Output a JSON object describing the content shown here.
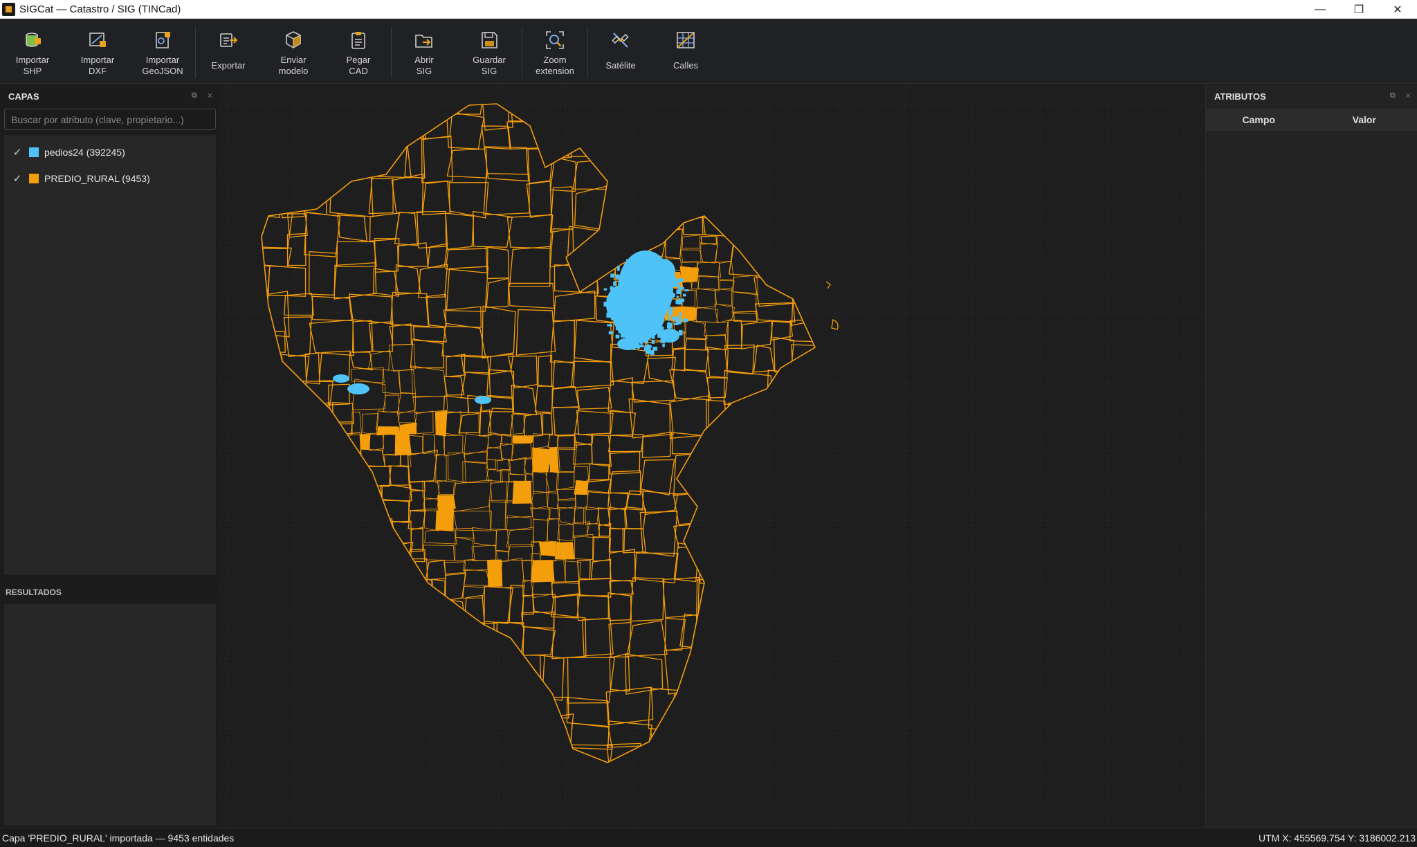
{
  "window": {
    "title": "SIGCat — Catastro / SIG (TINCad)",
    "minimize": "—",
    "maximize": "❐",
    "close": "✕"
  },
  "toolbar": {
    "import_shp": "Importar\nSHP",
    "import_dxf": "Importar\nDXF",
    "import_geojson": "Importar\nGeoJSON",
    "export": "Exportar",
    "send_model": "Enviar\nmodelo",
    "paste_cad": "Pegar\nCAD",
    "open_sig": "Abrir\nSIG",
    "save_sig": "Guardar\nSIG",
    "zoom_extent": "Zoom\nextension",
    "satellite": "Satélite",
    "streets": "Calles"
  },
  "layers_panel": {
    "title": "CAPAS",
    "search_placeholder": "Buscar por atributo (clave, propietario...)",
    "layers": [
      {
        "name": "pedios24  (392245)",
        "color": "#4fc3f7",
        "checked": true
      },
      {
        "name": "PREDIO_RURAL  (9453)",
        "color": "#f59e0b",
        "checked": true
      }
    ]
  },
  "results_panel": {
    "title": "RESULTADOS"
  },
  "attributes_panel": {
    "title": "ATRIBUTOS",
    "col_field": "Campo",
    "col_value": "Valor"
  },
  "map": {
    "parcel_color": "#f59e0b",
    "urban_color": "#4fc3f7",
    "background": "#1e1e1f"
  },
  "status": {
    "message": "Capa 'PREDIO_RURAL' importada — 9453 entidades",
    "coords": "UTM  X: 455569.754   Y: 3186002.213"
  }
}
